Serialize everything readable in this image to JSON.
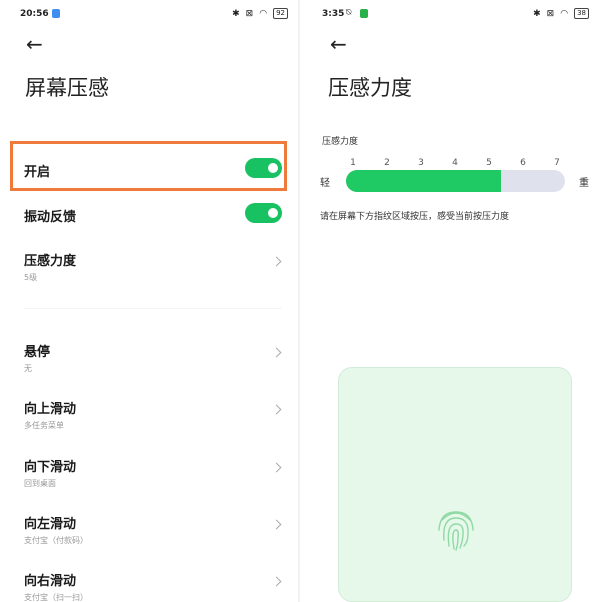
{
  "left": {
    "status": {
      "time": "20:56",
      "battery": "92"
    },
    "title": "屏幕压感",
    "items": [
      {
        "label": "开启",
        "toggle": true
      },
      {
        "label": "振动反馈",
        "toggle": true
      },
      {
        "label": "压感力度",
        "sub": "5级"
      },
      {
        "label": "悬停",
        "sub": "无"
      },
      {
        "label": "向上滑动",
        "sub": "多任务菜单"
      },
      {
        "label": "向下滑动",
        "sub": "回到桌面"
      },
      {
        "label": "向左滑动",
        "sub": "支付宝（付款码）"
      },
      {
        "label": "向右滑动",
        "sub": "支付宝（扫一扫）"
      }
    ]
  },
  "right": {
    "status": {
      "time": "3:35",
      "battery": "38"
    },
    "title": "压感力度",
    "section_label": "压感力度",
    "scale": {
      "ticks": [
        "1",
        "2",
        "3",
        "4",
        "5",
        "6",
        "7"
      ],
      "min_label": "轻",
      "max_label": "重",
      "value": 5,
      "max": 7
    },
    "hint": "请在屏幕下方指纹区域按压，感受当前按压力度"
  },
  "colors": {
    "accent": "#18c262",
    "highlight": "#ee7a3c",
    "track": "#dfe2ec",
    "fingerprint_area": "#e6f8ea"
  }
}
